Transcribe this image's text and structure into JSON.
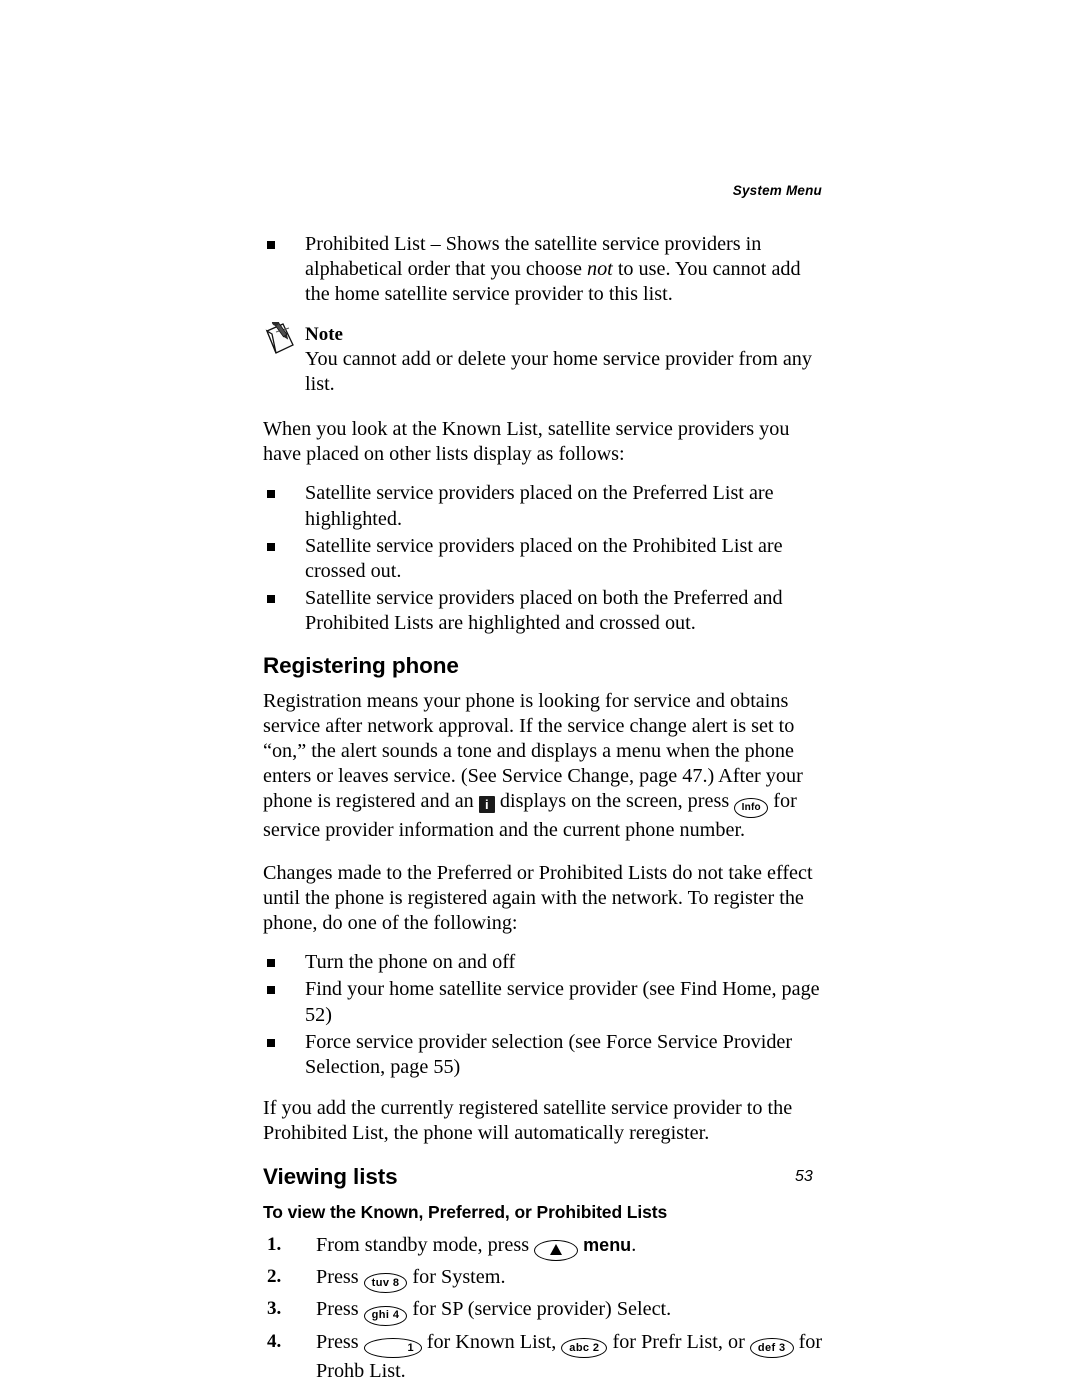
{
  "header": {
    "running_head": "System Menu"
  },
  "folio": {
    "page_number": "53"
  },
  "intro_bullets": [
    {
      "pre": "Prohibited List – Shows the satellite service providers in alphabetical order that you choose ",
      "italic": "not",
      "post": " to use. You cannot add the home satellite service provider to this list."
    }
  ],
  "note": {
    "icon": "note-pen-icon",
    "title": "Note",
    "text": "You cannot add or delete your home service provider from any list."
  },
  "known_list": {
    "intro": "When you look at the Known List, satellite service providers you have placed on other lists display as follows:",
    "bullets": [
      "Satellite service providers placed on the Preferred List are highlighted.",
      "Satellite service providers placed on the Prohibited List are crossed out.",
      "Satellite service providers placed on both the Preferred and Prohibited Lists are highlighted and crossed out."
    ]
  },
  "registering": {
    "heading": "Registering phone",
    "para1_a": "Registration means your phone is looking for service and obtains service after network approval. If the service change alert is set to “on,” the alert sounds a tone and displays a menu when the phone enters or leaves service. (See Service Change, page 47.) After your phone is registered and an ",
    "info_badge_label": "i",
    "para1_b": " displays on the screen, press ",
    "info_key_label": "Info",
    "para1_c": " for service provider information and the current phone number.",
    "para2": "Changes made to the Preferred or Prohibited Lists do not take effect until the phone is registered again with the network. To register the phone, do one of the following:",
    "bullets": [
      "Turn the phone on and off",
      "Find your home satellite service provider (see Find Home, page 52)",
      "Force service provider selection (see Force Service Provider Selection, page 55)"
    ],
    "para3": "If you add the currently registered satellite service provider to the Prohibited List, the phone will automatically reregister."
  },
  "viewing": {
    "heading": "Viewing lists",
    "subheading": "To view the Known, Preferred, or Prohibited Lists",
    "steps": [
      {
        "num": "1.",
        "a": "From standby mode, press ",
        "key": "up-arrow-key",
        "b": "",
        "menu_word": "menu",
        "c": "."
      },
      {
        "num": "2.",
        "a": "Press ",
        "key_label": "tuv 8",
        "b": " for System."
      },
      {
        "num": "3.",
        "a": "Press ",
        "key_label": "ghi 4",
        "b": " for SP (service provider) Select."
      },
      {
        "num": "4.",
        "a": "Press ",
        "key1_label": "1",
        "b": " for Known List, ",
        "key2_label": "abc 2",
        "c": " for Prefr List, or ",
        "key3_label": "def 3",
        "d": " for Prohb List."
      }
    ]
  }
}
